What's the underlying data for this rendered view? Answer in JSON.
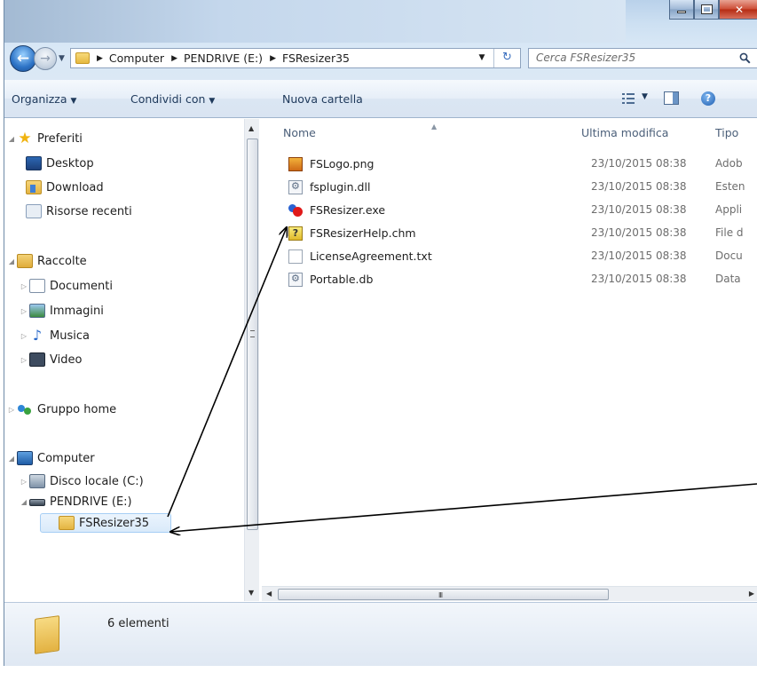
{
  "address": {
    "crumbs": [
      "Computer",
      "PENDRIVE (E:)",
      "FSResizer35"
    ],
    "search_placeholder": "Cerca FSResizer35"
  },
  "commands": {
    "organize": "Organizza",
    "share": "Condividi con",
    "new_folder": "Nuova cartella"
  },
  "nav": {
    "favorites": "Preferiti",
    "desktop": "Desktop",
    "download": "Download",
    "recent": "Risorse recenti",
    "libraries": "Raccolte",
    "documents": "Documenti",
    "images": "Immagini",
    "music": "Musica",
    "video": "Video",
    "homegroup": "Gruppo home",
    "computer": "Computer",
    "local_disk": "Disco locale (C:)",
    "pendrive": "PENDRIVE (E:)",
    "current_folder": "FSResizer35"
  },
  "columns": {
    "name": "Nome",
    "modified": "Ultima modifica",
    "type": "Tipo"
  },
  "files": [
    {
      "name": "FSLogo.png",
      "date": "23/10/2015 08:38",
      "type": "Adob",
      "icon": "png-file-icon"
    },
    {
      "name": "fsplugin.dll",
      "date": "23/10/2015 08:38",
      "type": "Esten",
      "icon": "dll-file-icon"
    },
    {
      "name": "FSResizer.exe",
      "date": "23/10/2015 08:38",
      "type": "Appli",
      "icon": "exe-app-icon"
    },
    {
      "name": "FSResizerHelp.chm",
      "date": "23/10/2015 08:38",
      "type": "File d",
      "icon": "help-file-icon"
    },
    {
      "name": "LicenseAgreement.txt",
      "date": "23/10/2015 08:38",
      "type": "Docu",
      "icon": "text-file-icon"
    },
    {
      "name": "Portable.db",
      "date": "23/10/2015 08:38",
      "type": "Data",
      "icon": "db-file-icon"
    }
  ],
  "status": {
    "count": "6 elementi"
  },
  "scrollbar": {
    "hgrip": "III"
  }
}
